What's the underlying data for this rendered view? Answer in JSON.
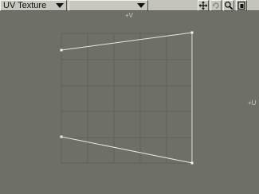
{
  "toolbar": {
    "texture_dropdown": {
      "value": "UV Texture"
    },
    "map_dropdown": {
      "value": ""
    },
    "buttons": [
      {
        "name": "move",
        "icon": "move-arrows-icon"
      },
      {
        "name": "rotate",
        "icon": "rotate-icon"
      },
      {
        "name": "zoom",
        "icon": "magnifier-icon"
      },
      {
        "name": "maximize",
        "icon": "maximize-viewport-icon"
      }
    ]
  },
  "viewport": {
    "axis_v_label": "+V",
    "axis_u_label": "+U",
    "grid_visible": true,
    "colors": {
      "background": "#6e7068",
      "grid": "#5f615a",
      "mesh": "#e8e8e2",
      "axis_text": "#c9cac2"
    }
  }
}
